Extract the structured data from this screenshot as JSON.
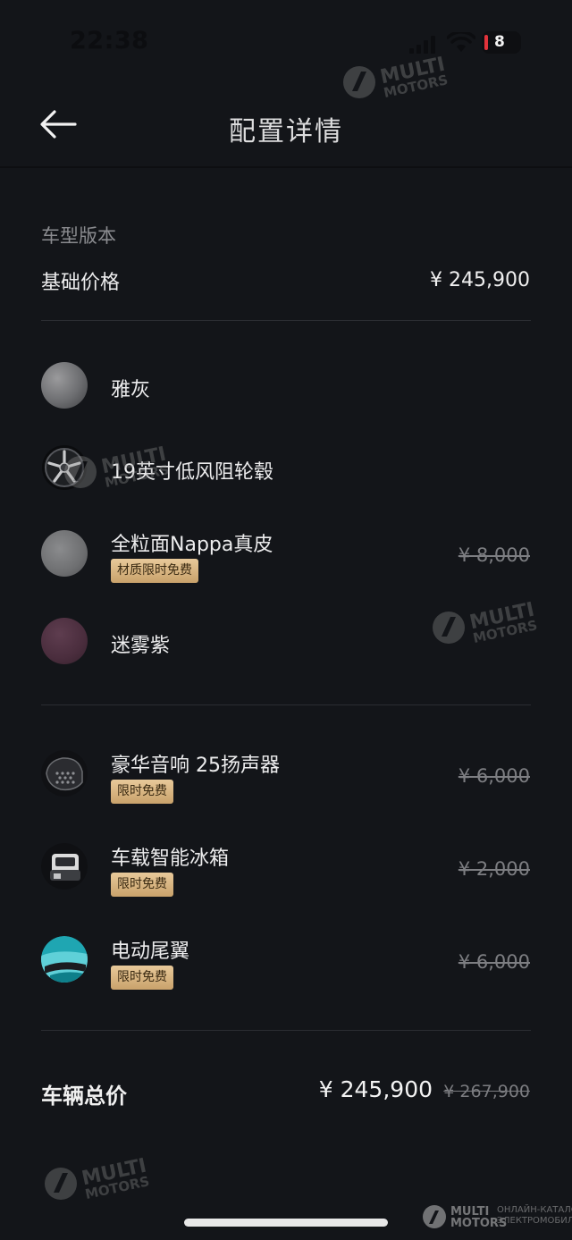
{
  "status_bar": {
    "time": "22:38",
    "battery": "8"
  },
  "nav": {
    "title": "配置详情"
  },
  "version": {
    "section_label": "车型版本",
    "base_label": "基础价格",
    "base_price": "¥ 245,900"
  },
  "options": [
    {
      "name": "雅灰",
      "badge": "",
      "price": "",
      "icon": "gray-paint-swatch"
    },
    {
      "name": "19英寸低风阻轮毂",
      "badge": "",
      "price": "",
      "icon": "wheel"
    },
    {
      "name": "全粒面Nappa真皮",
      "badge": "材质限时免费",
      "price": "¥ 8,000",
      "icon": "leather-swatch"
    },
    {
      "name": "迷雾紫",
      "badge": "",
      "price": "",
      "icon": "purple-swatch"
    }
  ],
  "extras": [
    {
      "name": "豪华音响 25扬声器",
      "badge": "限时免费",
      "price": "¥ 6,000",
      "icon": "speaker"
    },
    {
      "name": "车载智能冰箱",
      "badge": "限时免费",
      "price": "¥ 2,000",
      "icon": "fridge"
    },
    {
      "name": "电动尾翼",
      "badge": "限时免费",
      "price": "¥ 6,000",
      "icon": "spoiler"
    }
  ],
  "total": {
    "label": "车辆总价",
    "price": "¥ 245,900",
    "original_price": "¥ 267,900"
  },
  "watermark": {
    "line1": "MULTI",
    "line2": "MOTORS",
    "footer_line1": "ОНЛАЙН-КАТАЛОГ",
    "footer_line2": "ЭЛЕКТРОМОБИЛЕЙ"
  },
  "colors": {
    "background": "#131519",
    "badge_gold": "#d9b682",
    "divider": "#2b2d32"
  }
}
